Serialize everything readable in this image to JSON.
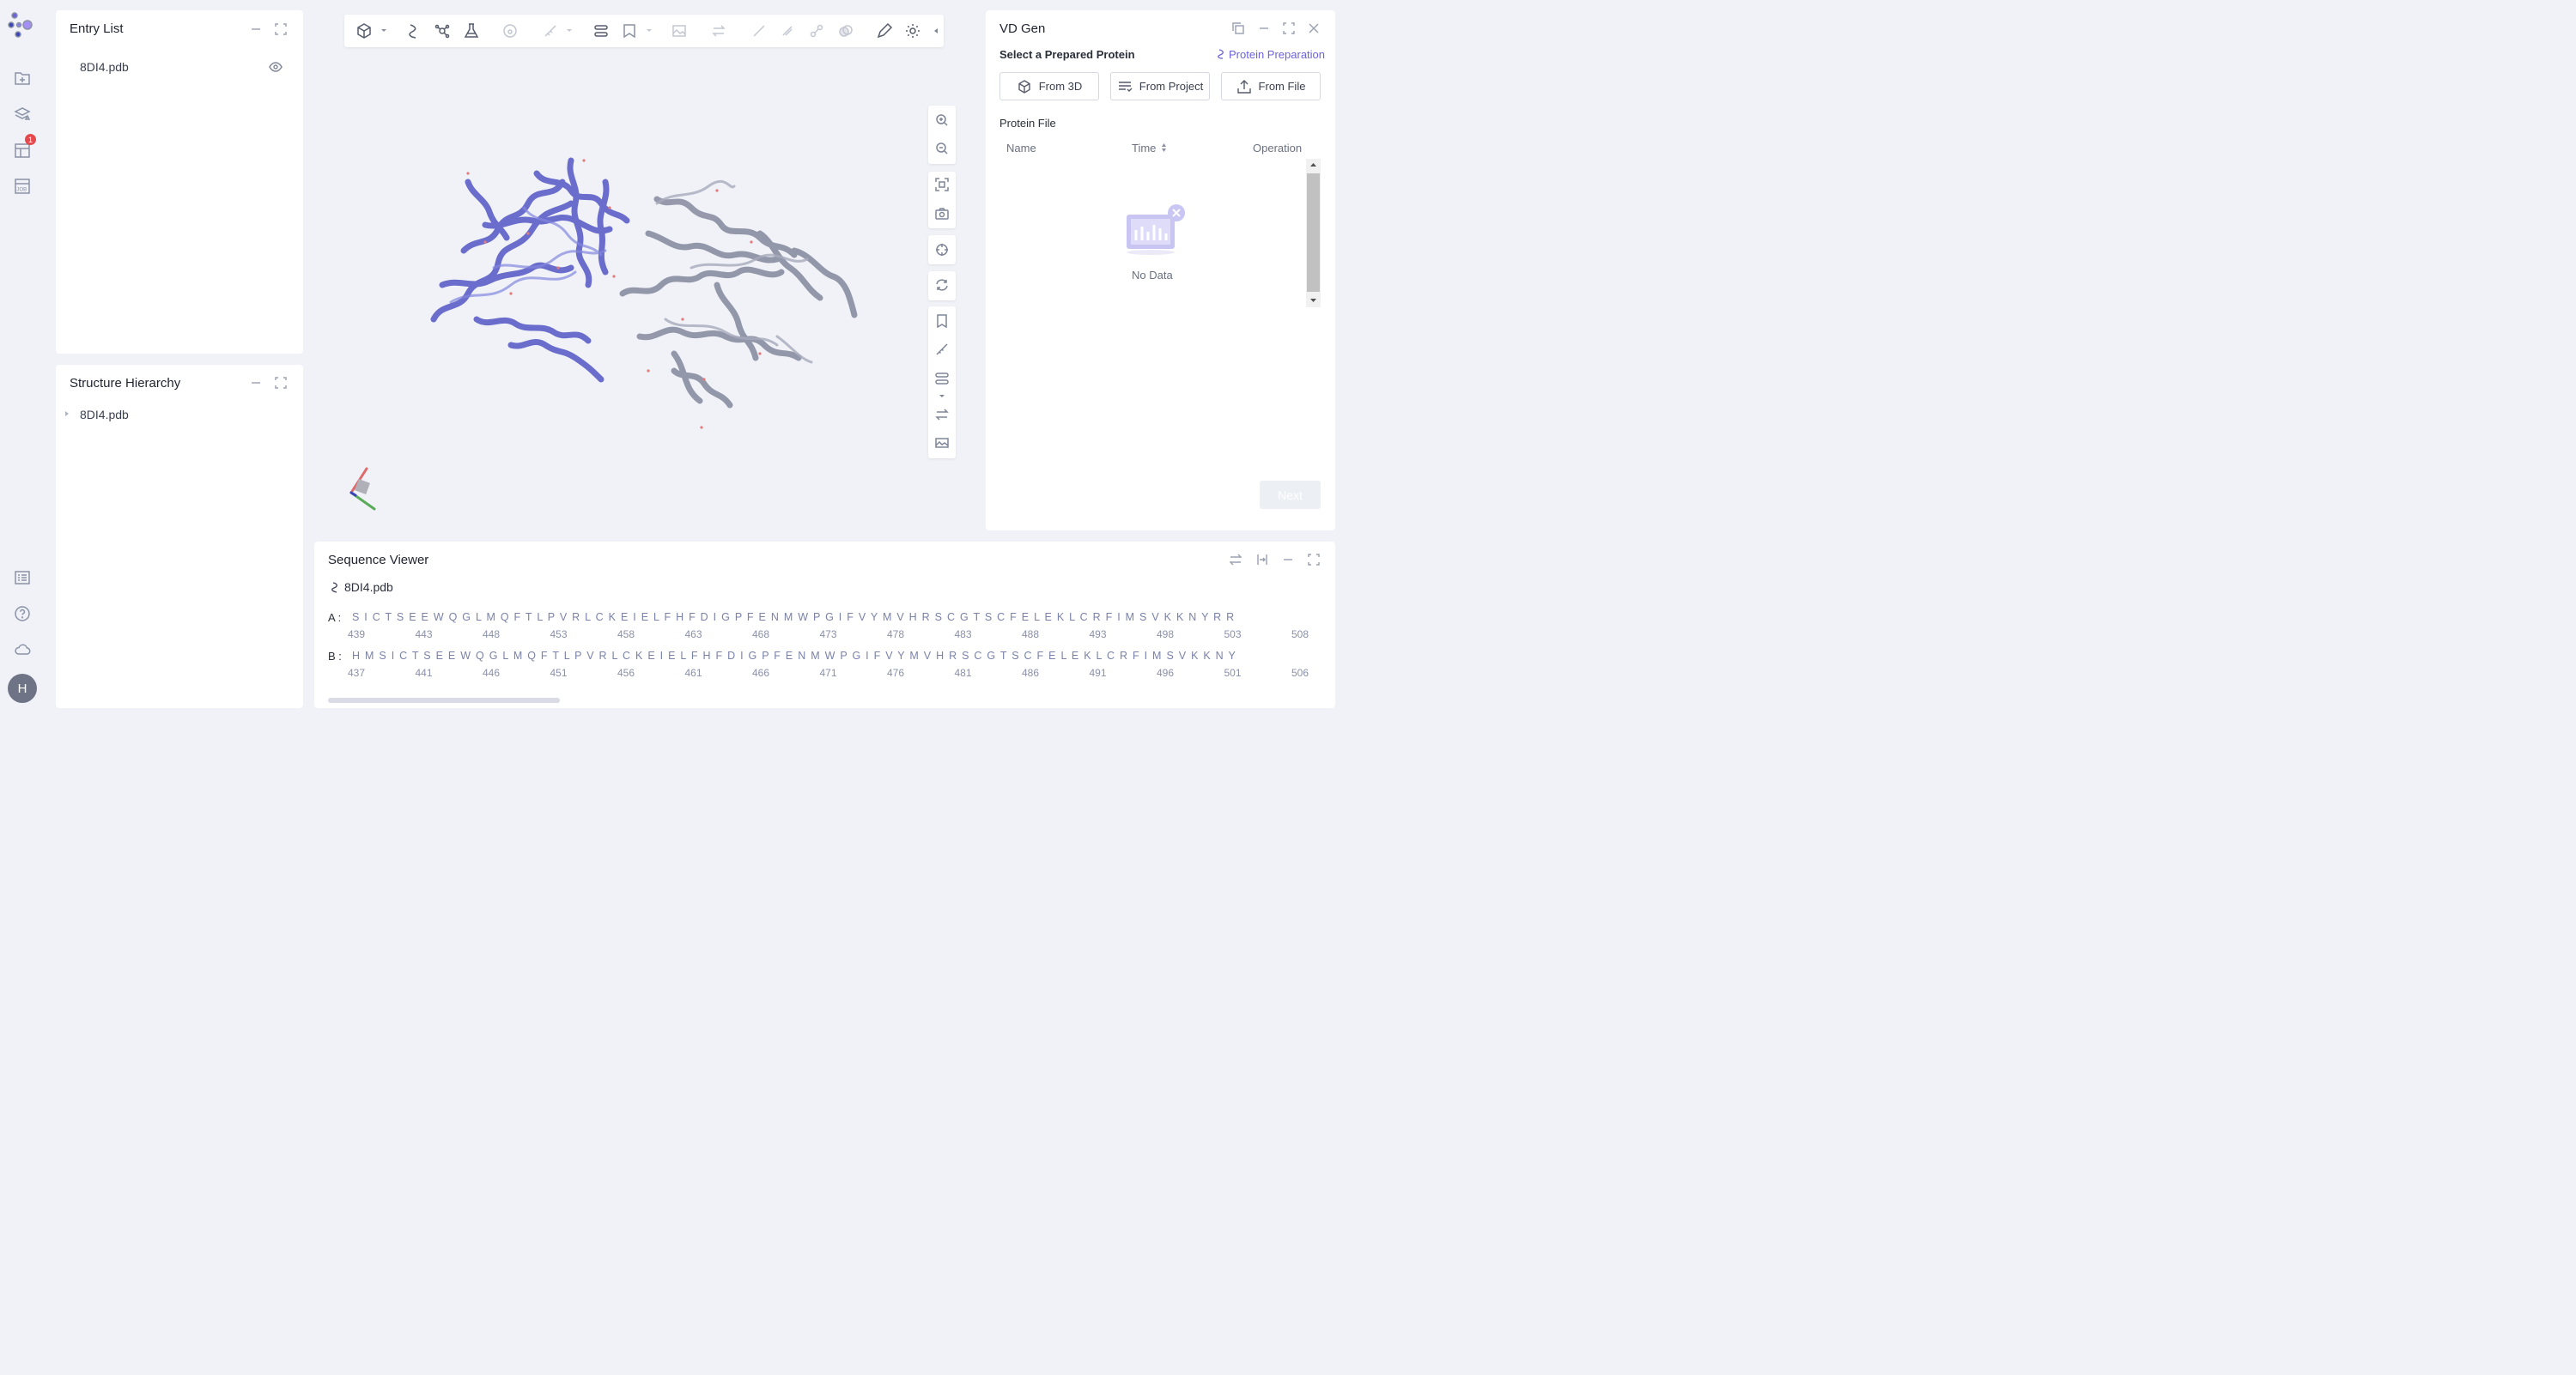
{
  "rail": {
    "badge_count": "1",
    "avatar_initial": "H"
  },
  "entry_list": {
    "title": "Entry List",
    "items": [
      "8DI4.pdb"
    ]
  },
  "structure_hierarchy": {
    "title": "Structure Hierarchy",
    "items": [
      "8DI4.pdb"
    ]
  },
  "vd_gen": {
    "title": "VD Gen",
    "select_label": "Select a Prepared Protein",
    "prep_link": "Protein Preparation",
    "buttons": [
      "From 3D",
      "From Project",
      "From File"
    ],
    "protein_file_label": "Protein File",
    "columns": [
      "Name",
      "Time",
      "Operation"
    ],
    "empty_text": "No Data",
    "next_label": "Next"
  },
  "sequence_viewer": {
    "title": "Sequence Viewer",
    "file": "8DI4.pdb",
    "chains": [
      {
        "label": "A :",
        "sequence": "S I C T S E E W Q G L M Q F T L P V R L C K E I E L F H F D I G P F E N M W P G I F V Y M V H R S C G T S C F E L E K L C R F I M S V K K N Y R R",
        "numbers": [
          "439",
          "443",
          "448",
          "453",
          "458",
          "463",
          "468",
          "473",
          "478",
          "483",
          "488",
          "493",
          "498",
          "503",
          "508"
        ]
      },
      {
        "label": "B :",
        "sequence": "H M S I C T S E E W Q G L M Q F T L P V R L C K E I E L F H F D I G P F E N M W P G I F V Y M V H R S C G T S C F E L E K L C R F I M S V K K N Y",
        "numbers": [
          "437",
          "441",
          "446",
          "451",
          "456",
          "461",
          "466",
          "471",
          "476",
          "481",
          "486",
          "491",
          "496",
          "501",
          "506"
        ]
      }
    ]
  },
  "colors": {
    "accent": "#6c63d9",
    "chain_a": "#6366c9",
    "chain_b": "#8f93a6"
  }
}
